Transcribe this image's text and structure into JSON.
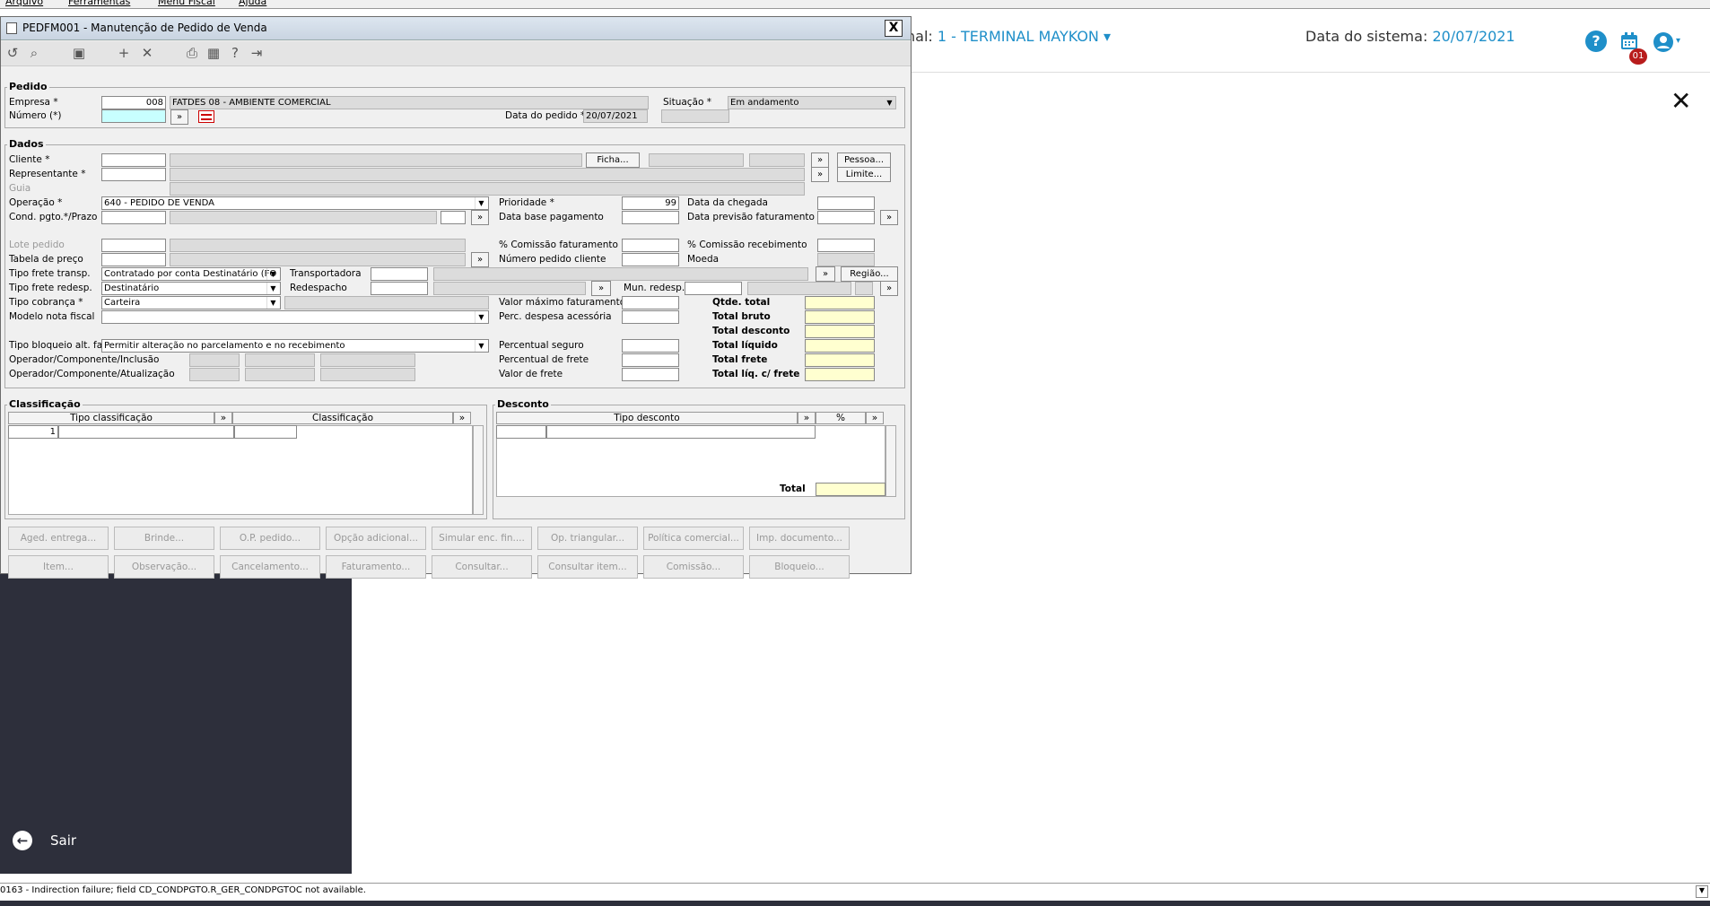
{
  "os_menu": [
    "Arquivo",
    "Ferramentas",
    "Menu Fiscal",
    "Ajuda"
  ],
  "header": {
    "terminal_prefix": "nal:",
    "terminal_value": "1 - TERMINAL MAYKON",
    "date_label": "Data do sistema:",
    "date_value": "20/07/2021",
    "notification_count": "01",
    "accent_color": "#1f8fc9"
  },
  "sidebar": {
    "exit_label": "Sair"
  },
  "status_bar": {
    "message": "0163 - Indirection failure; field CD_CONDPGTO.R_GER_CONDPGTOC not available."
  },
  "window": {
    "title": "PEDFM001 - Manutenção de Pedido de Venda",
    "close": "X"
  },
  "pedido": {
    "legend": "Pedido",
    "empresa_label": "Empresa *",
    "empresa_code": "008",
    "empresa_name": "FATDES 08 - AMBIENTE COMERCIAL",
    "numero_label": "Número (*)",
    "numero_value": "",
    "situacao_label": "Situação *",
    "situacao_value": "Em andamento",
    "data_label": "Data do pedido *",
    "data_value": "20/07/2021",
    "more": "»"
  },
  "dados": {
    "legend": "Dados",
    "cliente": "Cliente *",
    "ficha": "Ficha...",
    "pessoa": "Pessoa...",
    "representante": "Representante *",
    "limite": "Limite...",
    "guia": "Guia",
    "operacao": "Operação *",
    "operacao_value": "640 - PEDIDO DE VENDA",
    "cond": "Cond. pgto.*/Prazo",
    "lote": "Lote pedido",
    "tabela": "Tabela de preço",
    "tipo_frete": "Tipo frete transp.",
    "tipo_frete_value": "Contratado por conta Destinatário (FO",
    "tipo_frete_redesp": "Tipo frete redesp.",
    "tipo_frete_redesp_value": "Destinatário",
    "tipo_cobranca": "Tipo cobrança *",
    "tipo_cobranca_value": "Carteira",
    "modelo": "Modelo nota fiscal",
    "tipo_bloqueio": "Tipo bloqueio alt. fat.",
    "tipo_bloqueio_value": "Permitir alteração no parcelamento e no recebimento",
    "op_inclusao": "Operador/Componente/Inclusão",
    "op_atualizacao": "Operador/Componente/Atualização",
    "transportadora": "Transportadora",
    "redespacho": "Redespacho",
    "regiao": "Região...",
    "mun_redesp": "Mun. redesp.",
    "prioridade": "Prioridade *",
    "prioridade_value": "99",
    "data_base": "Data base pagamento",
    "comissao_fat": "% Comissão faturamento",
    "numero_cliente": "Número pedido cliente",
    "valor_max": "Valor máximo faturamento",
    "perc_despesa": "Perc. despesa acessória",
    "perc_seguro": "Percentual seguro",
    "perc_frete": "Percentual de frete",
    "valor_frete": "Valor de frete",
    "data_chegada": "Data da chegada",
    "data_previsao": "Data previsão faturamento",
    "comissao_rec": "% Comissão recebimento",
    "moeda": "Moeda",
    "qtde_total": "Qtde. total",
    "total_bruto": "Total bruto",
    "total_desconto": "Total desconto",
    "total_liquido": "Total líquido",
    "total_frete": "Total frete",
    "total_liq_frete": "Total líq. c/ frete"
  },
  "classificacao": {
    "legend": "Classificação",
    "col1": "Tipo classificação",
    "col2": "Classificação",
    "row_num": "1"
  },
  "desconto": {
    "legend": "Desconto",
    "col1": "Tipo desconto",
    "col2": "%",
    "total": "Total"
  },
  "bottom_buttons_row1": [
    "Aged. entrega...",
    "Brinde...",
    "O.P. pedido...",
    "Opção adicional...",
    "Simular enc. fin....",
    "Op. triangular...",
    "Política comercial...",
    "Imp. documento..."
  ],
  "bottom_buttons_row2": [
    "Item...",
    "Observação...",
    "Cancelamento...",
    "Faturamento...",
    "Consultar...",
    "Consultar item...",
    "Comissão...",
    "Bloqueio..."
  ]
}
